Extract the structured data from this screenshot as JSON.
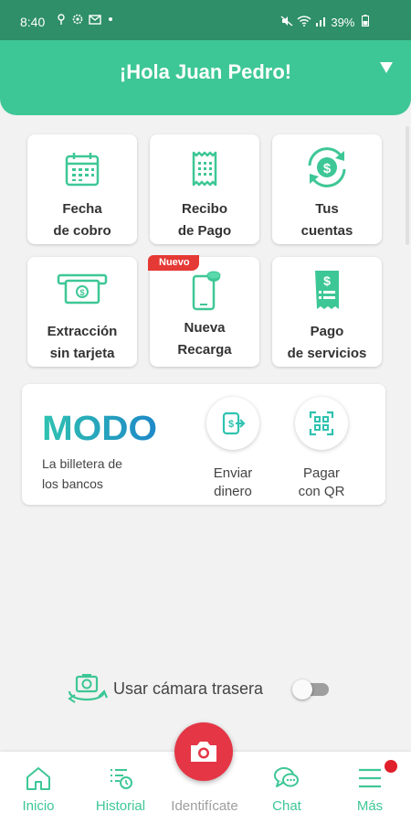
{
  "status_bar": {
    "time": "8:40",
    "left_icons": "♀ ⚙ ✉ •",
    "right_icons": "🔇 ≡ .∥",
    "battery": "39%"
  },
  "header": {
    "greeting": "¡Hola Juan Pedro!"
  },
  "tiles": [
    {
      "line1": "Fecha",
      "line2": "de cobro",
      "icon": "calendar-icon"
    },
    {
      "line1": "Recibo",
      "line2": "de Pago",
      "icon": "receipt-icon"
    },
    {
      "line1": "Tus",
      "line2": "cuentas",
      "icon": "accounts-icon"
    },
    {
      "line1": "Extracción",
      "line2": "sin tarjeta",
      "icon": "cash-withdrawal-icon"
    },
    {
      "line1": "Nueva",
      "line2": "Recarga",
      "icon": "phone-recharge-icon",
      "badge": "Nuevo"
    },
    {
      "line1": "Pago",
      "line2": "de servicios",
      "icon": "bill-payment-icon"
    }
  ],
  "modo": {
    "logo": "MODO",
    "tagline_line1": "La billetera de",
    "tagline_line2": "los bancos",
    "actions": [
      {
        "line1": "Enviar",
        "line2": "dinero",
        "icon": "send-money-icon"
      },
      {
        "line1": "Pagar",
        "line2": "con QR",
        "icon": "qr-scan-icon"
      }
    ]
  },
  "camera_option": {
    "label": "Usar cámara trasera",
    "enabled": false
  },
  "bottom_nav": {
    "items": [
      {
        "label": "Inicio",
        "icon": "home-icon"
      },
      {
        "label": "Historial",
        "icon": "history-icon"
      },
      {
        "label": "Identifícate",
        "icon": "camera-icon"
      },
      {
        "label": "Chat",
        "icon": "chat-icon"
      },
      {
        "label": "Más",
        "icon": "menu-icon"
      }
    ]
  },
  "colors": {
    "primary": "#3ec796",
    "status_bar": "#2e8f68",
    "accent_red": "#e53646",
    "modo_teal": "#2fc2b0",
    "modo_blue": "#1e88c8"
  }
}
